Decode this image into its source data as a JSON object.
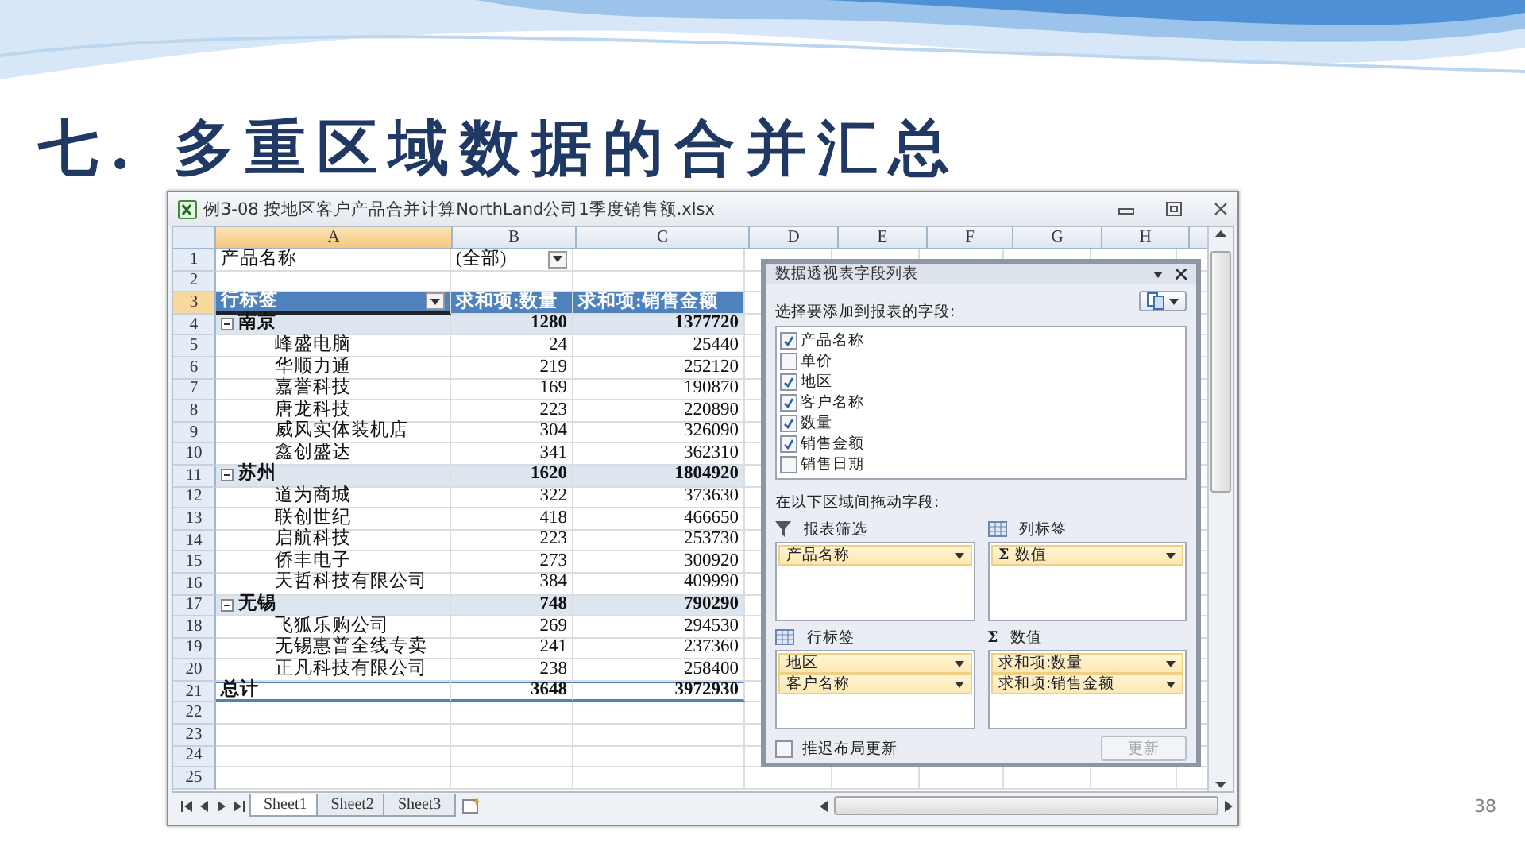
{
  "slide": {
    "title": "七. 多重区域数据的合并汇总",
    "page_number": "38"
  },
  "window": {
    "title": "例3-08 按地区客户产品合并计算NorthLand公司1季度销售额.xlsx"
  },
  "sheet": {
    "columns": [
      {
        "label": "A",
        "selected": true
      },
      {
        "label": "B",
        "selected": false
      },
      {
        "label": "C",
        "selected": false
      },
      {
        "label": "D",
        "selected": false
      },
      {
        "label": "E",
        "selected": false
      },
      {
        "label": "F",
        "selected": false
      },
      {
        "label": "G",
        "selected": false
      },
      {
        "label": "H",
        "selected": false
      }
    ],
    "row_numbers": [
      {
        "label": "1",
        "selected": false
      },
      {
        "label": "2",
        "selected": false
      },
      {
        "label": "3",
        "selected": true
      },
      {
        "label": "4",
        "selected": false
      },
      {
        "label": "5",
        "selected": false
      },
      {
        "label": "6",
        "selected": false
      },
      {
        "label": "7",
        "selected": false
      },
      {
        "label": "8",
        "selected": false
      },
      {
        "label": "9",
        "selected": false
      },
      {
        "label": "10",
        "selected": false
      },
      {
        "label": "11",
        "selected": false
      },
      {
        "label": "12",
        "selected": false
      },
      {
        "label": "13",
        "selected": false
      },
      {
        "label": "14",
        "selected": false
      },
      {
        "label": "15",
        "selected": false
      },
      {
        "label": "16",
        "selected": false
      },
      {
        "label": "17",
        "selected": false
      },
      {
        "label": "18",
        "selected": false
      },
      {
        "label": "19",
        "selected": false
      },
      {
        "label": "20",
        "selected": false
      },
      {
        "label": "21",
        "selected": false
      },
      {
        "label": "22",
        "selected": false
      },
      {
        "label": "23",
        "selected": false
      },
      {
        "label": "24",
        "selected": false
      },
      {
        "label": "25",
        "selected": false
      }
    ],
    "filter": {
      "label": "产品名称",
      "value": "(全部)"
    },
    "header": [
      "行标签",
      "求和项:数量",
      "求和项:销售金额"
    ],
    "groups": [
      {
        "label": "南京",
        "qty": "1280",
        "amount": "1377720",
        "expanded": true,
        "children": [
          {
            "label": "峰盛电脑",
            "qty": "24",
            "amount": "25440"
          },
          {
            "label": "华顺力通",
            "qty": "219",
            "amount": "252120"
          },
          {
            "label": "嘉誉科技",
            "qty": "169",
            "amount": "190870"
          },
          {
            "label": "唐龙科技",
            "qty": "223",
            "amount": "220890"
          },
          {
            "label": "威风实体装机店",
            "qty": "304",
            "amount": "326090"
          },
          {
            "label": "鑫创盛达",
            "qty": "341",
            "amount": "362310"
          }
        ]
      },
      {
        "label": "苏州",
        "qty": "1620",
        "amount": "1804920",
        "expanded": true,
        "children": [
          {
            "label": "道为商城",
            "qty": "322",
            "amount": "373630"
          },
          {
            "label": "联创世纪",
            "qty": "418",
            "amount": "466650"
          },
          {
            "label": "启航科技",
            "qty": "223",
            "amount": "253730"
          },
          {
            "label": "侨丰电子",
            "qty": "273",
            "amount": "300920"
          },
          {
            "label": "天哲科技有限公司",
            "qty": "384",
            "amount": "409990"
          }
        ]
      },
      {
        "label": "无锡",
        "qty": "748",
        "amount": "790290",
        "expanded": true,
        "children": [
          {
            "label": "飞狐乐购公司",
            "qty": "269",
            "amount": "294530"
          },
          {
            "label": "无锡惠普全线专卖",
            "qty": "241",
            "amount": "237360"
          },
          {
            "label": "正凡科技有限公司",
            "qty": "238",
            "amount": "258400"
          }
        ]
      }
    ],
    "total": {
      "label": "总计",
      "qty": "3648",
      "amount": "3972930"
    }
  },
  "sheet_tabs": [
    {
      "label": "Sheet1",
      "selected": true
    },
    {
      "label": "Sheet2",
      "selected": false
    },
    {
      "label": "Sheet3",
      "selected": false
    }
  ],
  "pane": {
    "title": "数据透视表字段列表",
    "fields_prompt": "选择要添加到报表的字段:",
    "fields": [
      {
        "label": "产品名称",
        "checked": true
      },
      {
        "label": "单价",
        "checked": false
      },
      {
        "label": "地区",
        "checked": true
      },
      {
        "label": "客户名称",
        "checked": true
      },
      {
        "label": "数量",
        "checked": true
      },
      {
        "label": "销售金额",
        "checked": true
      },
      {
        "label": "销售日期",
        "checked": false
      }
    ],
    "drag_prompt": "在以下区域间拖动字段:",
    "areas": [
      {
        "kind": "filter",
        "title": "报表筛选",
        "items": [
          {
            "label": "产品名称"
          }
        ]
      },
      {
        "kind": "columns",
        "title": "列标签",
        "items": [
          {
            "icon": "Σ",
            "label": "数值"
          }
        ]
      },
      {
        "kind": "rows",
        "title": "行标签",
        "items": [
          {
            "label": "地区"
          },
          {
            "label": "客户名称"
          }
        ]
      },
      {
        "kind": "values",
        "icon": "Σ",
        "title": "数值",
        "items": [
          {
            "label": "求和项:数量"
          },
          {
            "label": "求和项:销售金额"
          }
        ]
      }
    ],
    "defer": {
      "label": "推迟布局更新",
      "checked": false
    },
    "update_button": {
      "label": "更新",
      "disabled": true
    }
  }
}
